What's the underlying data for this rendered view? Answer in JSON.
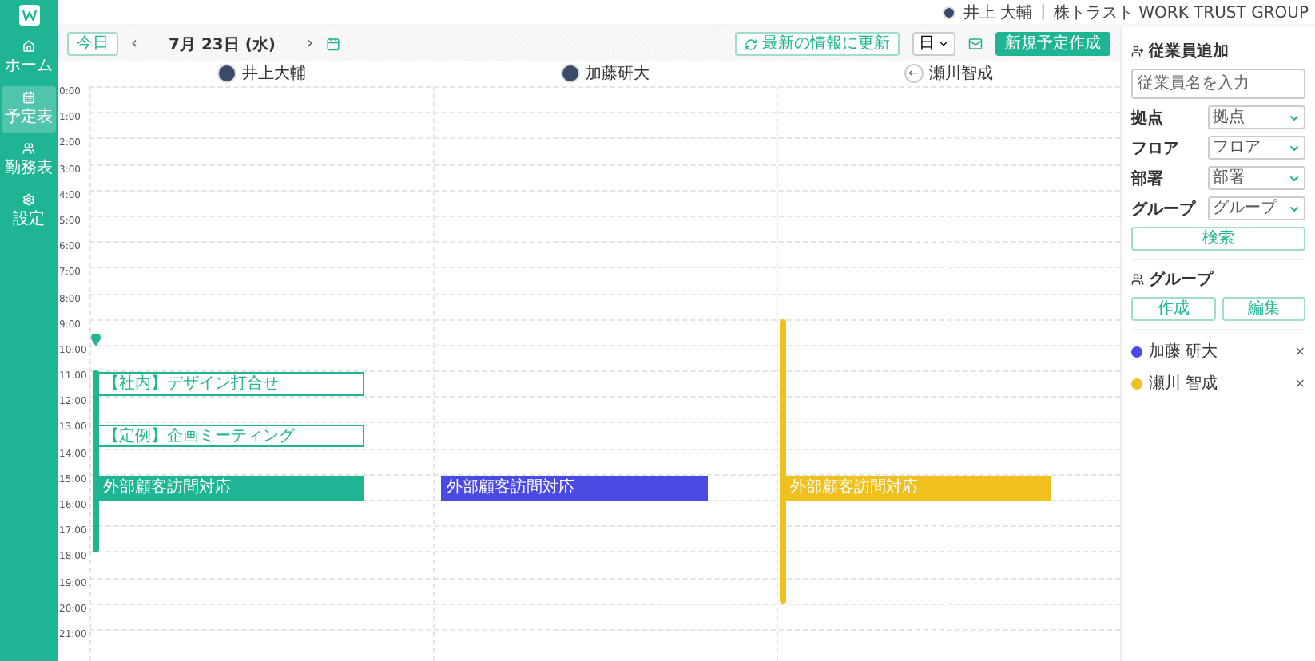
{
  "sidebar": {
    "items": [
      {
        "label": "ホーム",
        "selected": false
      },
      {
        "label": "予定表",
        "selected": true
      },
      {
        "label": "勤務表",
        "selected": false
      },
      {
        "label": "設定",
        "selected": false
      }
    ]
  },
  "header": {
    "user": "井上 大輔",
    "separator": "|",
    "company": "株トラスト WORK TRUST GROUP"
  },
  "toolbar": {
    "today": "今日",
    "prev": "‹",
    "date": "7月 23日 (水)",
    "next": "›",
    "refresh": "最新の情報に更新",
    "view": "日",
    "create": "新規予定作成"
  },
  "hours": [
    "0:00",
    "1:00",
    "2:00",
    "3:00",
    "4:00",
    "5:00",
    "6:00",
    "7:00",
    "8:00",
    "9:00",
    "10:00",
    "11:00",
    "12:00",
    "13:00",
    "14:00",
    "15:00",
    "16:00",
    "17:00",
    "18:00",
    "19:00",
    "20:00",
    "21:00"
  ],
  "columns": [
    {
      "name": "井上大輔",
      "avatar": {
        "kind": "photo"
      },
      "color": "#1fb594",
      "events": [
        {
          "kind": "outline",
          "title": "【社内】デザイン打合せ"
        },
        {
          "kind": "outline",
          "title": "【定例】企画ミーティング"
        },
        {
          "kind": "filled",
          "title": "外部顧客訪問対応"
        }
      ]
    },
    {
      "name": "加藤研大",
      "avatar": {
        "kind": "photo"
      },
      "color": "#4b49e3",
      "events": [
        {
          "kind": "filled",
          "title": "外部顧客訪問対応"
        }
      ]
    },
    {
      "name": "瀬川智成",
      "avatar": {
        "kind": "symbol",
        "symbol": "←"
      },
      "color": "#f0c01e",
      "events": [
        {
          "kind": "filled",
          "title": "外部顧客訪問対応"
        }
      ]
    }
  ],
  "panel": {
    "add_title": "従業員追加",
    "name_placeholder": "従業員名を入力",
    "filters": [
      {
        "label": "拠点",
        "value": "拠点"
      },
      {
        "label": "フロア",
        "value": "フロア"
      },
      {
        "label": "部署",
        "value": "部署"
      },
      {
        "label": "グループ",
        "value": "グループ"
      }
    ],
    "search": "検索",
    "group_title": "グループ",
    "create": "作成",
    "edit": "編集",
    "members": [
      {
        "name": "加藤 研大",
        "color": "#4b49e3",
        "remove": "✕"
      },
      {
        "name": "瀬川 智成",
        "color": "#f0c01e",
        "remove": "✕"
      }
    ]
  }
}
